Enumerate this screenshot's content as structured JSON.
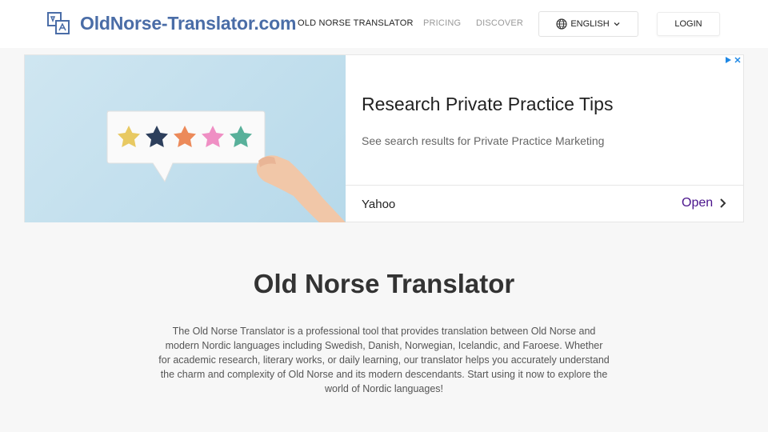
{
  "header": {
    "logo_text": "OldNorse-Translator.com",
    "nav": {
      "translator": "OLD NORSE TRANSLATOR",
      "pricing": "PRICING",
      "discover": "DISCOVER"
    },
    "language": "ENGLISH",
    "login": "LOGIN"
  },
  "ad": {
    "headline": "Research Private Practice Tips",
    "description": "See search results for Private Practice Marketing",
    "advertiser": "Yahoo",
    "cta": "Open",
    "cta_color": "#4a148c"
  },
  "main": {
    "title": "Old Norse Translator",
    "description": "The Old Norse Translator is a professional tool that provides translation between Old Norse and modern Nordic languages including Swedish, Danish, Norwegian, Icelandic, and Faroese. Whether for academic research, literary works, or daily learning, our translator helps you accurately understand the charm and complexity of Old Norse and its modern descendants. Start using it now to explore the world of Nordic languages!"
  },
  "colors": {
    "brand": "#4a6da7",
    "background": "#f7f7f7"
  },
  "icons": [
    "translate-logo-icon",
    "globe-icon",
    "chevron-down-icon",
    "ad-info-icon",
    "ad-close-icon",
    "chevron-right-icon"
  ]
}
